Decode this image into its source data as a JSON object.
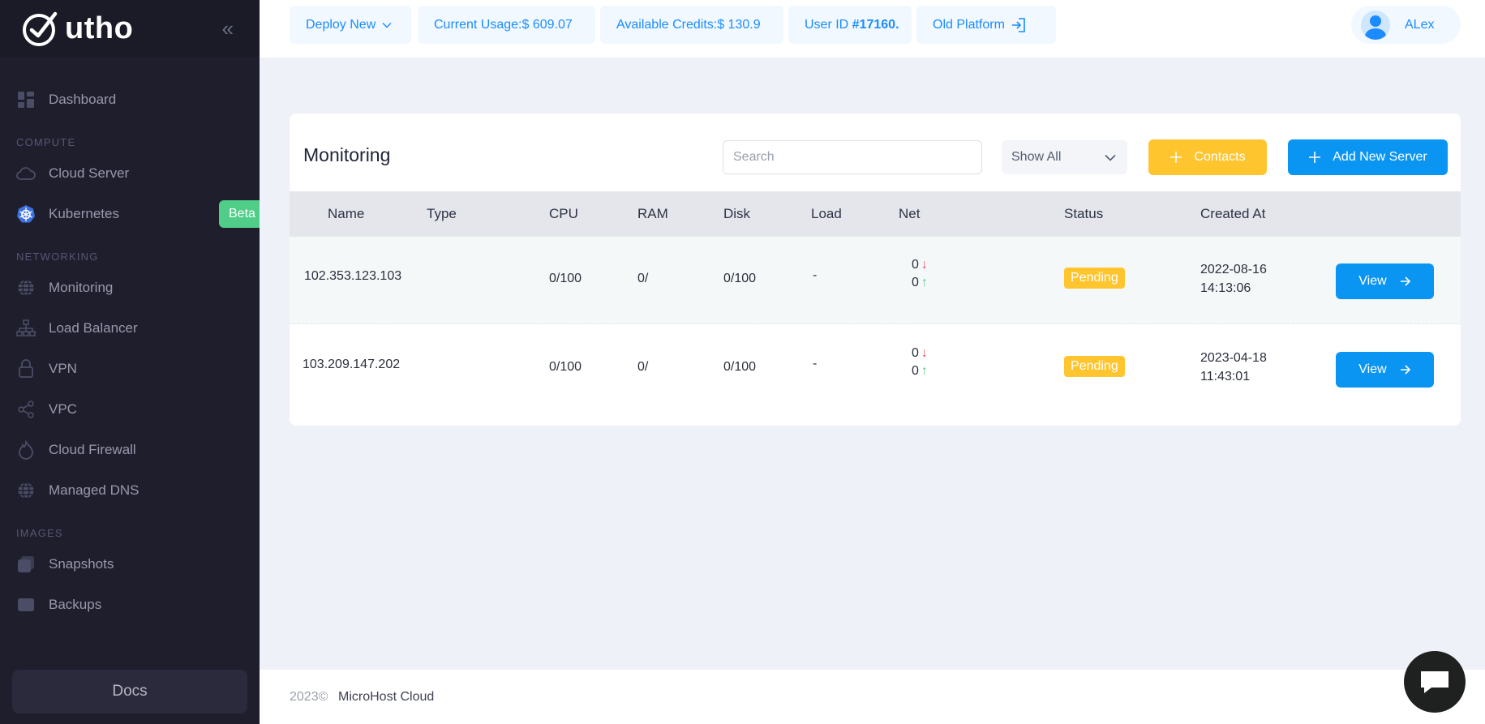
{
  "sidebar": {
    "logo_text": "utho",
    "items": [
      {
        "label": "Dashboard",
        "icon": "dashboard-icon"
      }
    ],
    "sections": [
      {
        "title": "COMPUTE",
        "items": [
          {
            "label": "Cloud Server"
          },
          {
            "label": "Kubernetes",
            "badge": "Beta"
          }
        ]
      },
      {
        "title": "NETWORKING",
        "items": [
          {
            "label": "Monitoring"
          },
          {
            "label": "Load Balancer"
          },
          {
            "label": "VPN"
          },
          {
            "label": "VPC"
          },
          {
            "label": "Cloud Firewall"
          },
          {
            "label": "Managed DNS"
          }
        ]
      },
      {
        "title": "IMAGES",
        "items": [
          {
            "label": "Snapshots"
          },
          {
            "label": "Backups"
          }
        ]
      }
    ],
    "docs_label": "Docs"
  },
  "topbar": {
    "deploy_new": "Deploy New",
    "current_usage": "Current Usage:$ 609.07",
    "available_credits": "Available Credits:$ 130.9",
    "user_id_prefix": "User ID ",
    "user_id": "#17160.",
    "old_platform": "Old Platform",
    "user_name": "ALex"
  },
  "card": {
    "title": "Monitoring",
    "search_placeholder": "Search",
    "filter_selected": "Show All",
    "contacts_label": "Contacts",
    "add_server_label": "Add New Server",
    "columns": [
      "Name",
      "Type",
      "CPU",
      "RAM",
      "Disk",
      "Load",
      "Net",
      "Status",
      "Created At"
    ],
    "rows": [
      {
        "name": "102.353.123.103",
        "type": "",
        "cpu": "0/100",
        "ram": "0/",
        "disk": "0/100",
        "load": "-",
        "net_down": "0",
        "net_up": "0",
        "status": "Pending",
        "created_date": "2022-08-16",
        "created_time": "14:13:06",
        "action": "View"
      },
      {
        "name": "103.209.147.202",
        "type": "",
        "cpu": "0/100",
        "ram": "0/",
        "disk": "0/100",
        "load": "-",
        "net_down": "0",
        "net_up": "0",
        "status": "Pending",
        "created_date": "2023-04-18",
        "created_time": "11:43:01",
        "action": "View"
      }
    ]
  },
  "footer": {
    "year": "2023©",
    "company": "MicroHost Cloud"
  },
  "colors": {
    "accent_blue": "#0b95f2",
    "accent_yellow": "#ffc52f",
    "sidebar_bg": "#1e1e2d",
    "beta_green": "#50cd89"
  }
}
